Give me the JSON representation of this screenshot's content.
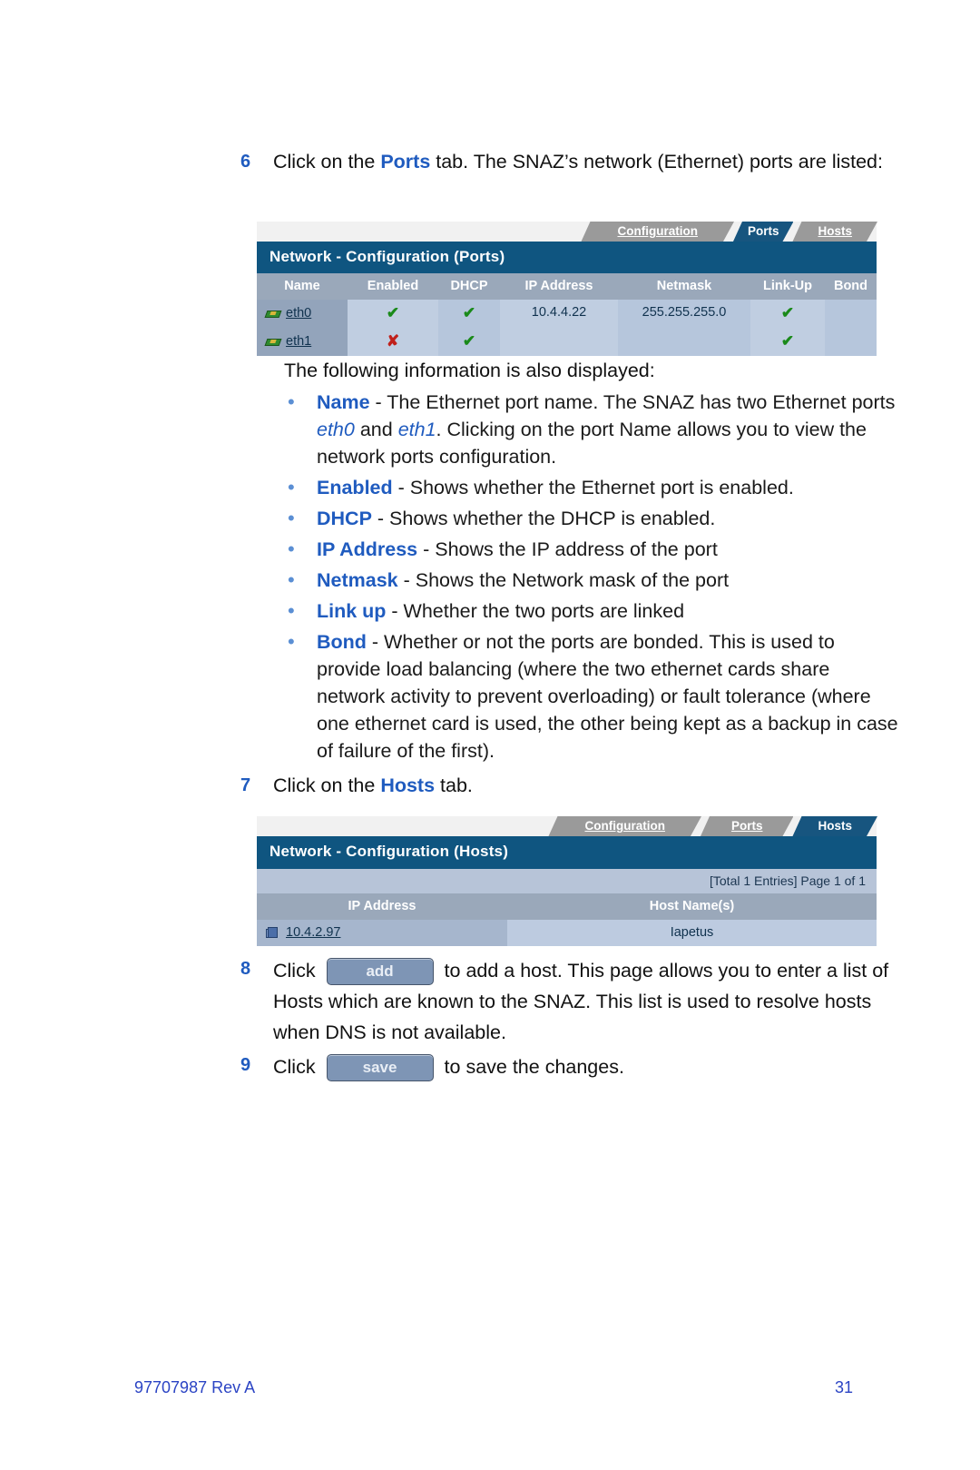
{
  "steps": {
    "step6": {
      "num": "6",
      "t1": "Click on the ",
      "b1": "Ports",
      "t2": " tab. The SNAZ’s network (Ethernet) ports are listed:"
    },
    "step7": {
      "num": "7",
      "t1": "Click on the ",
      "b1": "Hosts",
      "t2": " tab."
    },
    "step8": {
      "num": "8",
      "t1": "Click ",
      "button": "add",
      "t2": " to add a host. This page allows you to enter a list of Hosts which are known to the SNAZ. This list is used to resolve hosts when DNS is not available."
    },
    "step9": {
      "num": "9",
      "t1": "Click ",
      "button": "save",
      "t2": " to save the changes."
    }
  },
  "intro_para": "The following information is also displayed:",
  "bullets": [
    {
      "term": "Name",
      "text_a": " - The Ethernet port name. The SNAZ has two Ethernet ports ",
      "em1": "eth0",
      "text_b": " and ",
      "em2": "eth1",
      "text_c": ". Clicking on the port Name allows you to view the network ports configuration."
    },
    {
      "term": "Enabled",
      "text_a": " - Shows whether the Ethernet port is enabled."
    },
    {
      "term": "DHCP",
      "text_a": " - Shows whether the DHCP is enabled."
    },
    {
      "term": "IP Address",
      "text_a": " - Shows the IP address of the port"
    },
    {
      "term": "Netmask",
      "text_a": " - Shows the Network mask of the port"
    },
    {
      "term": "Link up",
      "text_a": " - Whether the two ports are linked"
    },
    {
      "term": "Bond",
      "text_a": " - Whether or not the ports are bonded. This is used to provide load balancing (where the two ethernet cards share network activity to prevent overloading) or fault tolerance (where one ethernet card is used, the other being kept as a backup in case of failure of the first)."
    }
  ],
  "ports_ui": {
    "tabs": [
      {
        "label": "Configuration",
        "active": false
      },
      {
        "label": "Ports",
        "active": true
      },
      {
        "label": "Hosts",
        "active": false
      }
    ],
    "title": "Network - Configuration (Ports)",
    "columns": [
      "Name",
      "Enabled",
      "DHCP",
      "IP Address",
      "Netmask",
      "Link-Up",
      "Bond"
    ],
    "rows": [
      {
        "name": "eth0",
        "enabled": "✔",
        "dhcp": "✔",
        "ip": "10.4.4.22",
        "netmask": "255.255.255.0",
        "linkup": "✔",
        "bond": ""
      },
      {
        "name": "eth1",
        "enabled": "✘",
        "dhcp": "✔",
        "ip": "",
        "netmask": "",
        "linkup": "✔",
        "bond": ""
      }
    ]
  },
  "hosts_ui": {
    "tabs": [
      {
        "label": "Configuration",
        "active": false
      },
      {
        "label": "Ports",
        "active": false
      },
      {
        "label": "Hosts",
        "active": true
      }
    ],
    "title": "Network - Configuration (Hosts)",
    "pager": "[Total 1 Entries] Page 1 of 1",
    "columns": [
      "IP Address",
      "Host Name(s)"
    ],
    "rows": [
      {
        "ip": "10.4.2.97",
        "hostname": "Iapetus"
      }
    ]
  },
  "footer": {
    "doc_id": "97707987 Rev A",
    "page_number": "31"
  },
  "colors": {
    "accent_blue": "#1f5bbf",
    "ui_header_blue": "#0f5580",
    "tab_gray": "#9a9a9a",
    "check_green": "#1a8a1a",
    "cross_red": "#c0201a",
    "footer_blue": "#2b44c4"
  }
}
